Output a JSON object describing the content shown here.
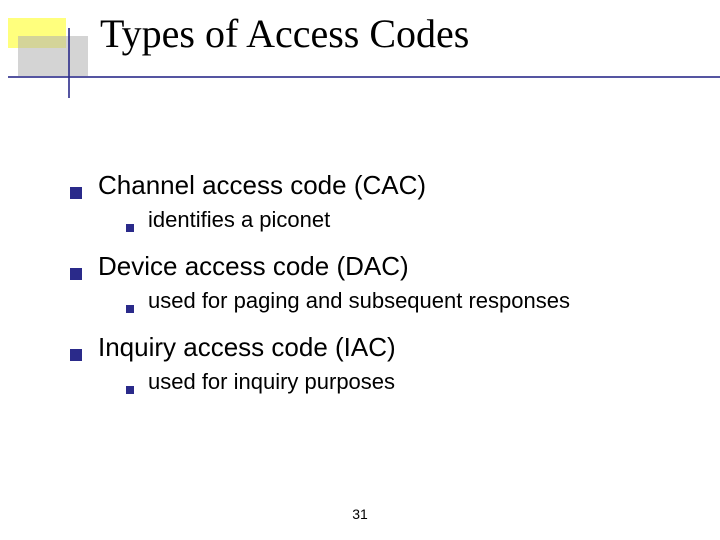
{
  "title": "Types of Access Codes",
  "items": [
    {
      "label": "Channel access code (CAC)",
      "sub": "identifies a piconet"
    },
    {
      "label": "Device access code (DAC)",
      "sub": "used for paging and subsequent responses"
    },
    {
      "label": "Inquiry access code (IAC)",
      "sub": "used for inquiry purposes"
    }
  ],
  "page_number": "31"
}
